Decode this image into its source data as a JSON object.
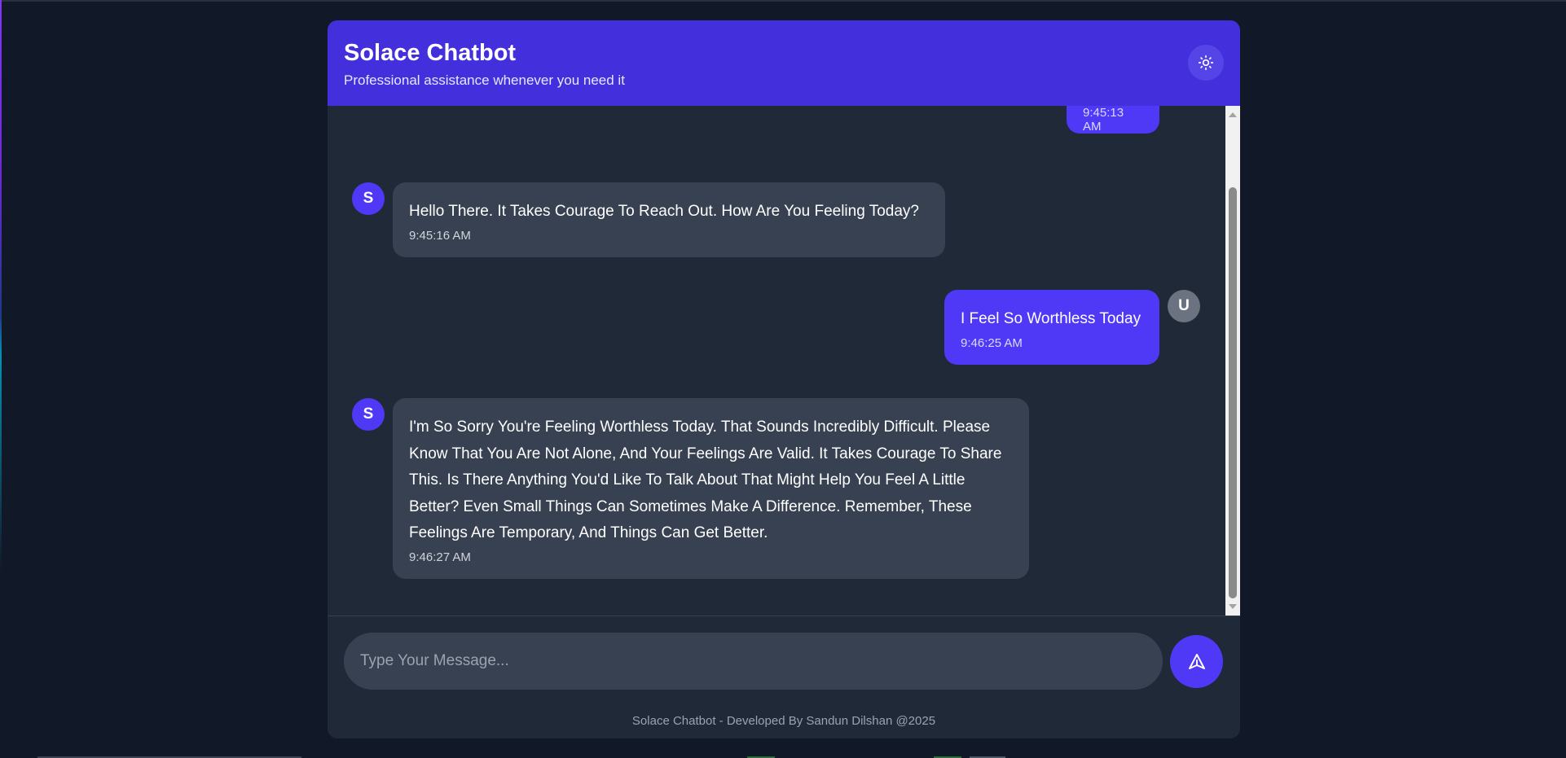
{
  "header": {
    "title": "Solace Chatbot",
    "subtitle": "Professional assistance whenever you need it",
    "theme_icon": "sun-icon"
  },
  "messages": [
    {
      "sender": "user",
      "avatar": "",
      "text": "",
      "time": "9:45:13 AM"
    },
    {
      "sender": "bot",
      "avatar": "S",
      "text": "Hello There. It Takes Courage To Reach Out. How Are You Feeling Today?",
      "time": "9:45:16 AM"
    },
    {
      "sender": "user",
      "avatar": "U",
      "text": "I Feel So Worthless Today",
      "time": "9:46:25 AM"
    },
    {
      "sender": "bot",
      "avatar": "S",
      "text": "I'm So Sorry You're Feeling Worthless Today. That Sounds Incredibly Difficult. Please Know That You Are Not Alone, And Your Feelings Are Valid. It Takes Courage To Share This. Is There Anything You'd Like To Talk About That Might Help You Feel A Little Better? Even Small Things Can Sometimes Make A Difference. Remember, These Feelings Are Temporary, And Things Can Get Better.",
      "time": "9:46:27 AM"
    }
  ],
  "composer": {
    "placeholder": "Type Your Message...",
    "value": "",
    "send_icon": "send-icon"
  },
  "footer": {
    "text": "Solace Chatbot - Developed By Sandun Dilshan @2025"
  },
  "colors": {
    "background": "#111827",
    "panel": "#1f2937",
    "header": "#4330dc",
    "accent": "#4f39f6",
    "bot_bubble": "#374151",
    "user_avatar": "#6b7280"
  }
}
